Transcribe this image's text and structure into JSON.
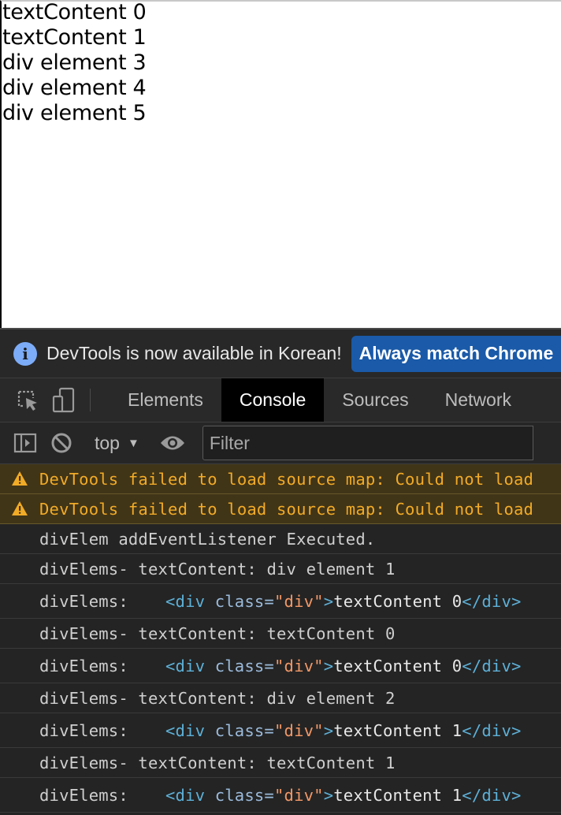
{
  "page": {
    "lines": [
      "textContent 0",
      "textContent 1",
      "div element 3",
      "div element 4",
      "div element 5"
    ]
  },
  "infobar": {
    "icon": "info-icon",
    "message": "DevTools is now available in Korean!",
    "button_label": "Always match Chrome"
  },
  "tabs": {
    "icons": [
      "inspect-element-icon",
      "device-toolbar-icon"
    ],
    "items": [
      "Elements",
      "Console",
      "Sources",
      "Network"
    ],
    "active": "Console"
  },
  "console_toolbar": {
    "context": "top",
    "filter_placeholder": "Filter",
    "icons": [
      "sidebar-toggle-icon",
      "clear-console-icon",
      "context-dropdown-icon",
      "live-expression-eye-icon"
    ]
  },
  "messages": [
    {
      "type": "warning",
      "text": "DevTools failed to load source map: Could not load"
    },
    {
      "type": "warning",
      "text": "DevTools failed to load source map: Could not load"
    },
    {
      "type": "log",
      "text": "divElem addEventListener Executed."
    },
    {
      "type": "log",
      "text": "divElems- textContent: div element 1"
    },
    {
      "type": "element",
      "label": "divElems:",
      "open_tag": "<div",
      "attr_name": "class=",
      "attr_value": "\"div\"",
      "close_bracket": ">",
      "content": "textContent 0",
      "end_tag": "</div>"
    },
    {
      "type": "log",
      "text": "divElems- textContent: textContent 0"
    },
    {
      "type": "element",
      "label": "divElems:",
      "open_tag": "<div",
      "attr_name": "class=",
      "attr_value": "\"div\"",
      "close_bracket": ">",
      "content": "textContent 0",
      "end_tag": "</div>"
    },
    {
      "type": "log",
      "text": "divElems- textContent: div element 2"
    },
    {
      "type": "element",
      "label": "divElems:",
      "open_tag": "<div",
      "attr_name": "class=",
      "attr_value": "\"div\"",
      "close_bracket": ">",
      "content": "textContent 1",
      "end_tag": "</div>"
    },
    {
      "type": "log",
      "text": "divElems- textContent: textContent 1"
    },
    {
      "type": "element",
      "label": "divElems:",
      "open_tag": "<div",
      "attr_name": "class=",
      "attr_value": "\"div\"",
      "close_bracket": ">",
      "content": "textContent 1",
      "end_tag": "</div>"
    }
  ],
  "colors": {
    "warning_text": "#f2ab26",
    "warning_bg": "#413518",
    "tag": "#5db0d7",
    "attr_value": "#f29766",
    "button_bg": "#1a5aa8"
  }
}
